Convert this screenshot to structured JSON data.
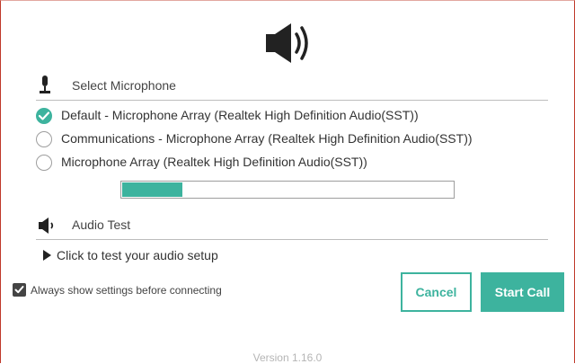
{
  "header": {
    "icon": "speaker-icon"
  },
  "microphone": {
    "section_label": "Select Microphone",
    "icon": "microphone-icon",
    "options": [
      {
        "label": "Default - Microphone Array (Realtek High Definition Audio(SST))",
        "selected": true
      },
      {
        "label": "Communications - Microphone Array (Realtek High Definition Audio(SST))",
        "selected": false
      },
      {
        "label": "Microphone Array (Realtek High Definition Audio(SST))",
        "selected": false
      }
    ],
    "input_level": 0.18
  },
  "audio_test": {
    "section_label": "Audio Test",
    "icon": "speaker-icon",
    "test_link": "Click to test your audio setup"
  },
  "settings": {
    "always_show_label": "Always show settings before connecting",
    "always_show_checked": true
  },
  "buttons": {
    "cancel": "Cancel",
    "start": "Start Call"
  },
  "footer": {
    "version": "Version 1.16.0"
  },
  "colors": {
    "accent": "#3db39e",
    "frame": "#c0392b"
  }
}
